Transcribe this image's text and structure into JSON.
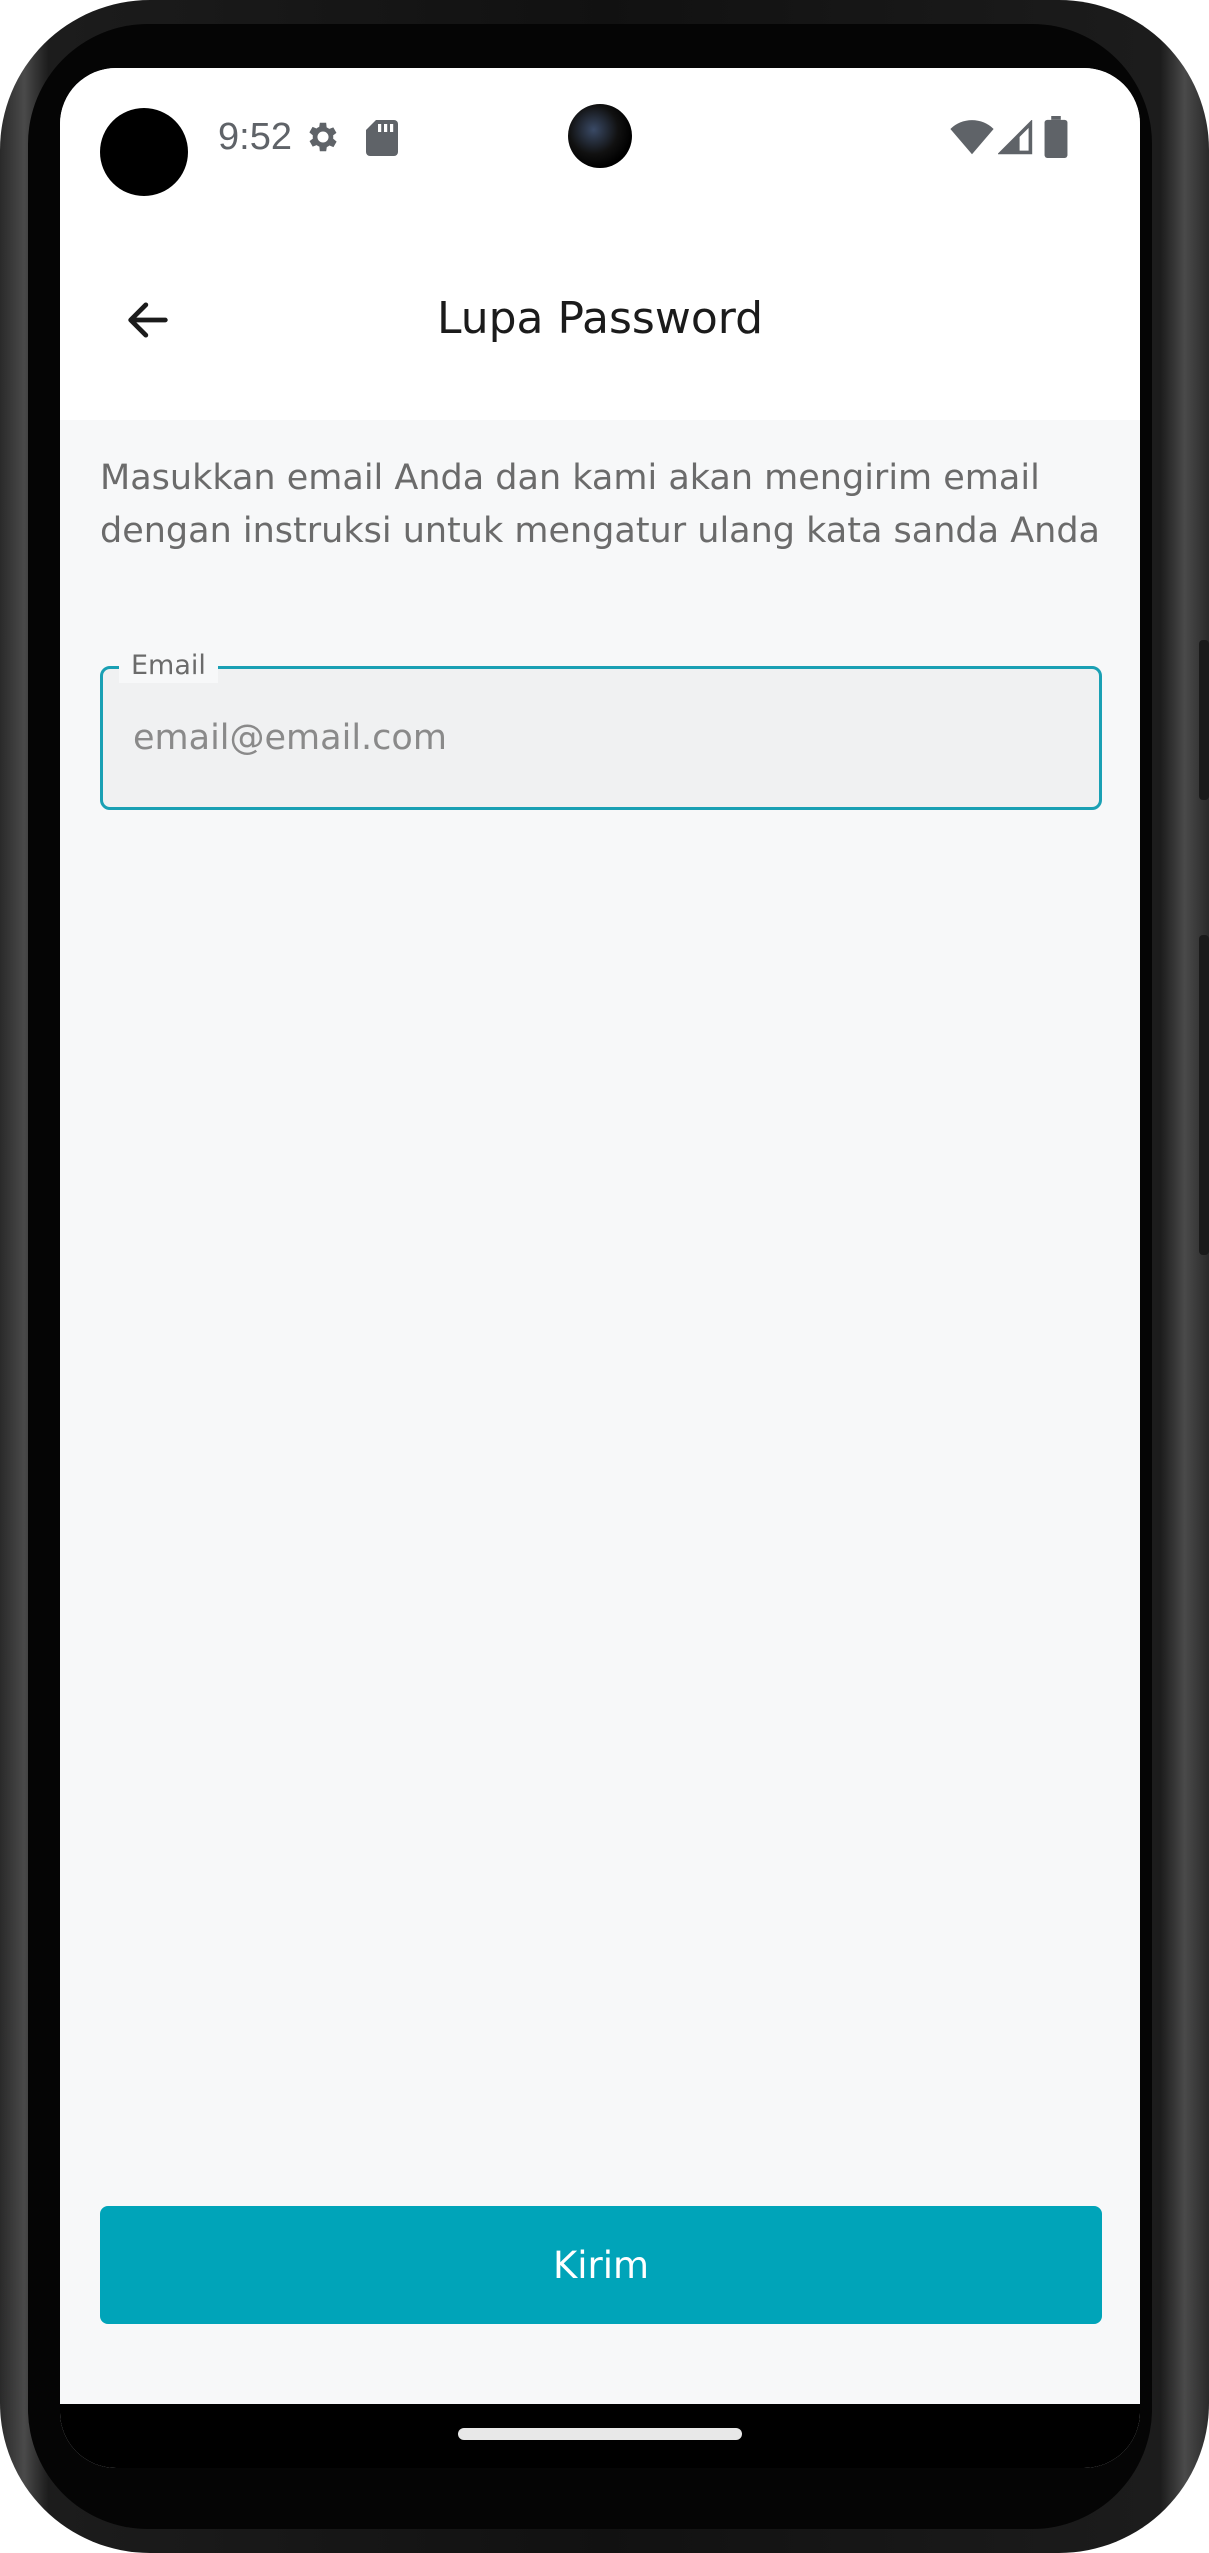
{
  "status_bar": {
    "time": "9:52",
    "icons": [
      "gear-icon",
      "sd-card-icon",
      "wifi-icon",
      "signal-icon",
      "battery-icon"
    ]
  },
  "app_bar": {
    "title": "Lupa Password",
    "back_icon": "arrow-left-icon"
  },
  "main": {
    "description": "Masukkan email Anda dan kami akan mengirim email dengan instruksi untuk mengatur ulang kata sanda Anda",
    "email_field": {
      "label": "Email",
      "placeholder": "email@email.com",
      "value": ""
    },
    "submit_label": "Kirim"
  },
  "colors": {
    "accent": "#00a4b9",
    "field_border": "#1aa0b4",
    "background": "#f7f8f9"
  }
}
